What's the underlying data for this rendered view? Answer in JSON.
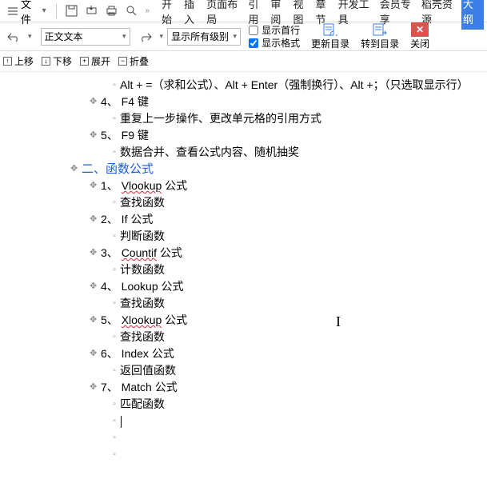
{
  "topbar": {
    "file_label": "文件",
    "tabs": [
      "开始",
      "插入",
      "页面布局",
      "引用",
      "审阅",
      "视图",
      "章节",
      "开发工具",
      "会员专享",
      "稻壳资源",
      "大纲"
    ]
  },
  "ribbon": {
    "style_combo": "正文文本",
    "level_combo": "显示所有级别",
    "show_first_line": "显示首行",
    "show_format": "显示格式",
    "update_toc": "更新目录",
    "goto_toc": "转到目录",
    "close": "关闭"
  },
  "row2": {
    "up": "上移",
    "down": "下移",
    "expand": "展开",
    "collapse": "折叠"
  },
  "doc": {
    "lines": [
      {
        "lvl": 3,
        "h": "b",
        "t": "Alt + =（求和公式）、Alt + Enter（强制换行）、Alt +；（只选取显示行）"
      },
      {
        "lvl": 2,
        "h": "p",
        "t": "4、 F4 键"
      },
      {
        "lvl": 3,
        "h": "b",
        "t": "重复上一步操作、更改单元格的引用方式"
      },
      {
        "lvl": 2,
        "h": "p",
        "t": "5、 F9 键"
      },
      {
        "lvl": 3,
        "h": "b",
        "t": "数据合并、查看公式内容、随机抽奖"
      },
      {
        "lvl": 1,
        "h": "p",
        "t": "二、函数公式",
        "cls": "heading"
      },
      {
        "lvl": 2,
        "h": "p",
        "t": "1、 Vlookup 公式",
        "sp": [
          "Vlookup"
        ]
      },
      {
        "lvl": 3,
        "h": "b",
        "t": "查找函数"
      },
      {
        "lvl": 2,
        "h": "p",
        "t": "2、 If 公式"
      },
      {
        "lvl": 3,
        "h": "b",
        "t": "判断函数"
      },
      {
        "lvl": 2,
        "h": "p",
        "t": "3、 Countif 公式",
        "sp": [
          "Countif"
        ]
      },
      {
        "lvl": 3,
        "h": "b",
        "t": "计数函数"
      },
      {
        "lvl": 2,
        "h": "p",
        "t": "4、 Lookup 公式"
      },
      {
        "lvl": 3,
        "h": "b",
        "t": "查找函数"
      },
      {
        "lvl": 2,
        "h": "p",
        "t": "5、 Xlookup 公式",
        "sp": [
          "Xlookup"
        ]
      },
      {
        "lvl": 3,
        "h": "b",
        "t": "查找函数"
      },
      {
        "lvl": 2,
        "h": "p",
        "t": "6、 Index 公式"
      },
      {
        "lvl": 3,
        "h": "b",
        "t": "返回值函数"
      },
      {
        "lvl": 2,
        "h": "p",
        "t": "7、 Match 公式"
      },
      {
        "lvl": 3,
        "h": "b",
        "t": "匹配函数"
      },
      {
        "lvl": 3,
        "h": "b",
        "t": "",
        "caret": true
      },
      {
        "lvl": 3,
        "h": "b",
        "t": ""
      },
      {
        "lvl": 3,
        "h": "b",
        "t": ""
      }
    ]
  }
}
